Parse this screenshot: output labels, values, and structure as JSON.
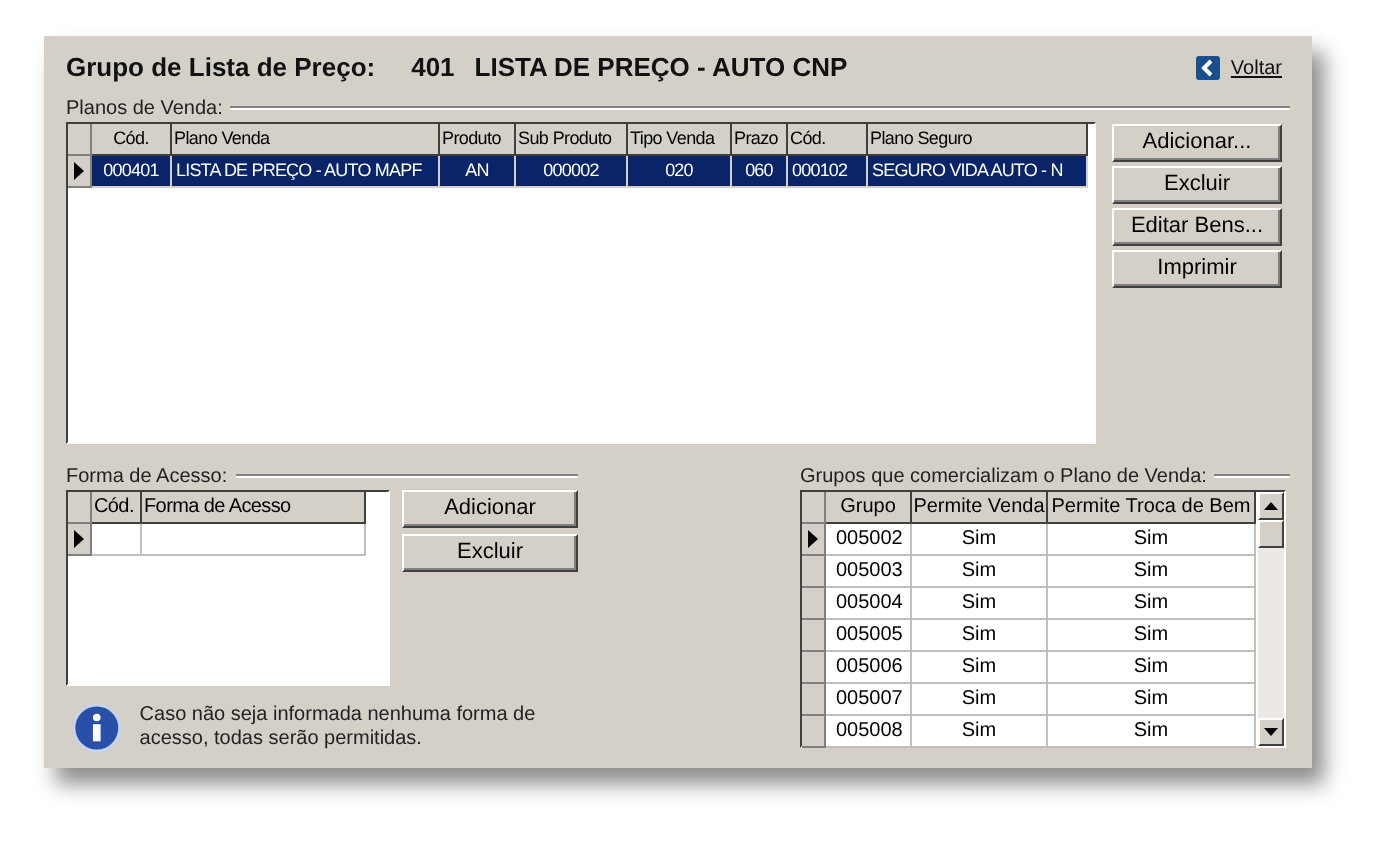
{
  "header": {
    "title": "Grupo de Lista de Preço:",
    "code": "401",
    "name": "LISTA DE PREÇO - AUTO CNP",
    "back_link": "Voltar"
  },
  "planos": {
    "label": "Planos de Venda:",
    "columns": [
      "Cód.",
      "Plano Venda",
      "Produto",
      "Sub Produto",
      "Tipo Venda",
      "Prazo",
      "Cód.",
      "Plano Seguro"
    ],
    "rows": [
      {
        "selected": true,
        "cells": [
          "000401",
          "LISTA DE PREÇO - AUTO MAPF",
          "AN",
          "000002",
          "020",
          "060",
          "000102",
          "SEGURO VIDA AUTO - N"
        ]
      }
    ],
    "buttons": [
      "Adicionar...",
      "Excluir",
      "Editar Bens...",
      "Imprimir"
    ]
  },
  "forma_acesso": {
    "label": "Forma de Acesso:",
    "columns": [
      "Cód.",
      "Forma de Acesso"
    ],
    "rows": [
      {
        "selected": true,
        "cells": [
          "",
          ""
        ]
      }
    ],
    "buttons": [
      "Adicionar",
      "Excluir"
    ],
    "info": "Caso não seja informada nenhuma forma de acesso, todas serão permitidas."
  },
  "grupos": {
    "label": "Grupos que comercializam o Plano de Venda:",
    "columns": [
      "Grupo",
      "Permite Venda",
      "Permite Troca de Bem"
    ],
    "rows": [
      {
        "selected": true,
        "cells": [
          "005002",
          "Sim",
          "Sim"
        ]
      },
      {
        "selected": false,
        "cells": [
          "005003",
          "Sim",
          "Sim"
        ]
      },
      {
        "selected": false,
        "cells": [
          "005004",
          "Sim",
          "Sim"
        ]
      },
      {
        "selected": false,
        "cells": [
          "005005",
          "Sim",
          "Sim"
        ]
      },
      {
        "selected": false,
        "cells": [
          "005006",
          "Sim",
          "Sim"
        ]
      },
      {
        "selected": false,
        "cells": [
          "005007",
          "Sim",
          "Sim"
        ]
      },
      {
        "selected": false,
        "cells": [
          "005008",
          "Sim",
          "Sim"
        ]
      }
    ]
  }
}
